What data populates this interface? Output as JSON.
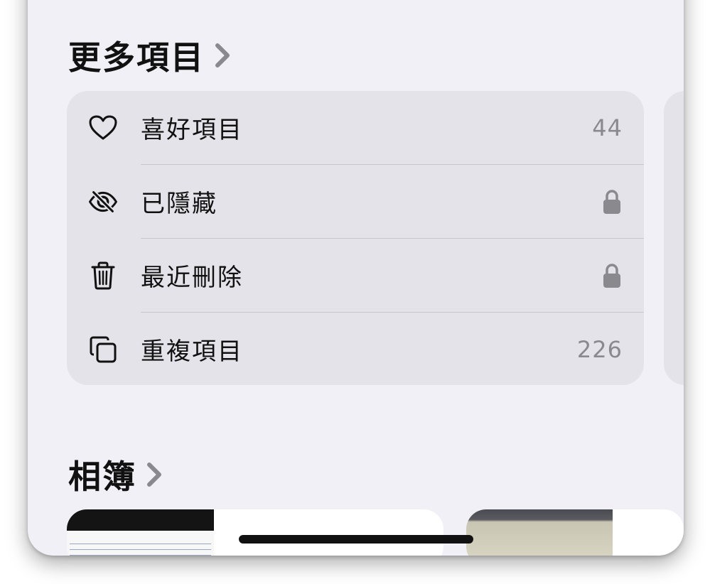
{
  "more_items": {
    "title": "更多項目",
    "rows": [
      {
        "label": "喜好項目",
        "value": "44",
        "icon": "heart-icon"
      },
      {
        "label": "已隱藏",
        "value": "",
        "icon": "eye-slash-icon",
        "locked": true
      },
      {
        "label": "最近刪除",
        "value": "",
        "icon": "trash-icon",
        "locked": true
      },
      {
        "label": "重複項目",
        "value": "226",
        "icon": "duplicate-icon"
      }
    ]
  },
  "albums": {
    "title": "相簿"
  },
  "colors": {
    "background": "#f1f0f6",
    "card": "#e4e3e9",
    "secondary_text": "#8a8a8e",
    "chevron": "#8a8a8e"
  }
}
